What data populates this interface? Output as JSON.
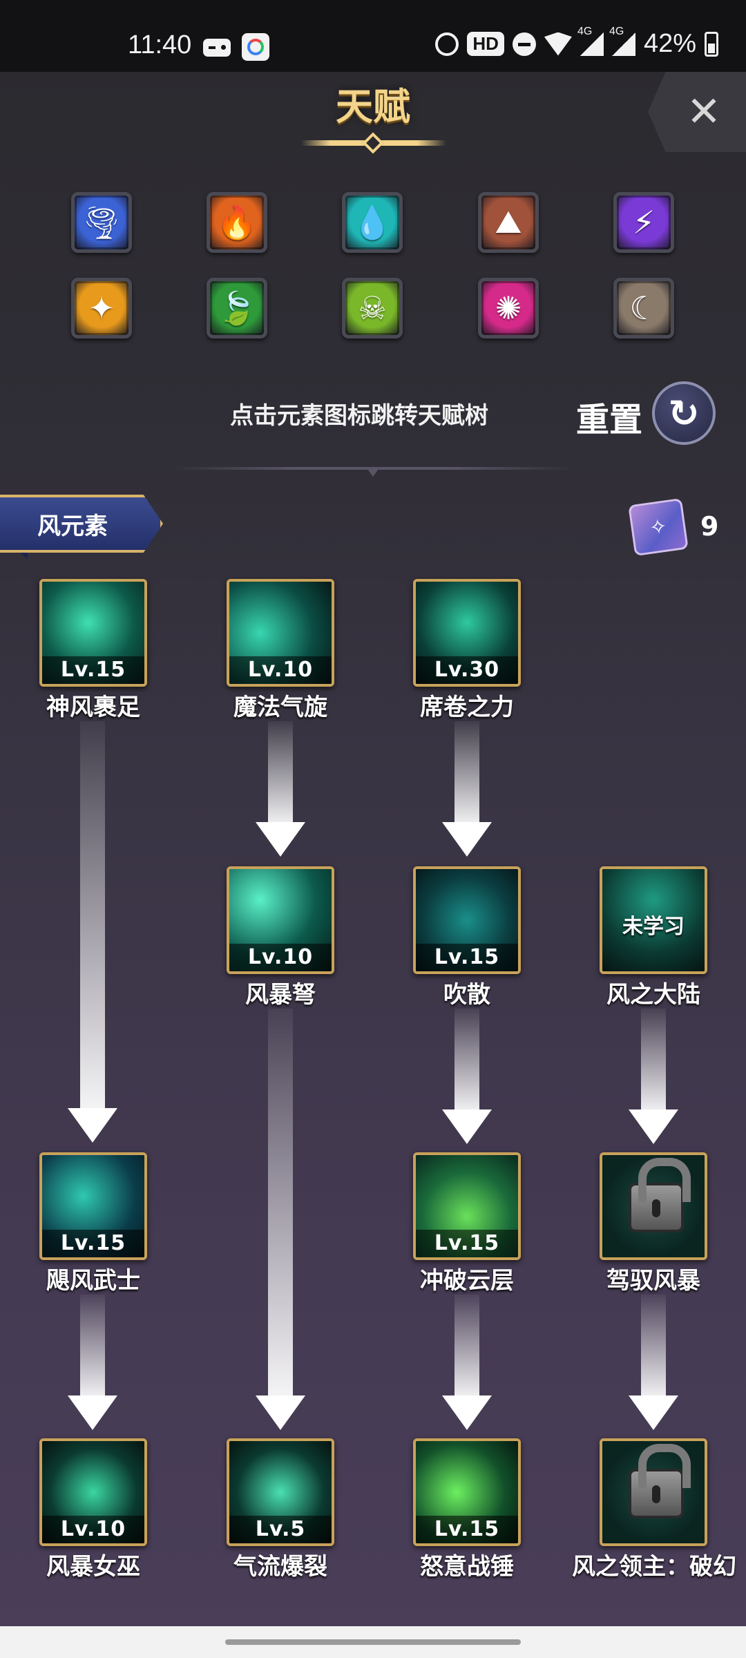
{
  "status_bar": {
    "time": "11:40",
    "hd_label": "HD",
    "network_1": "4G",
    "network_2": "4G",
    "battery": "42%"
  },
  "header": {
    "title": "天赋",
    "close_symbol": "✕"
  },
  "elements": [
    {
      "name": "tornado-icon",
      "glyph": "🌪",
      "color": "#3c63d6"
    },
    {
      "name": "fire-icon",
      "glyph": "🔥",
      "color": "#e0631e"
    },
    {
      "name": "water-drop-icon",
      "glyph": "💧",
      "color": "#1fb6b6"
    },
    {
      "name": "earth-crack-icon",
      "glyph": "⛰",
      "color": "#a0523a"
    },
    {
      "name": "lightning-icon",
      "glyph": "⚡",
      "color": "#7a3ad6"
    },
    {
      "name": "light-prism-icon",
      "glyph": "✦",
      "color": "#e89a1c"
    },
    {
      "name": "leaf-icon",
      "glyph": "🍃",
      "color": "#2e9a3a"
    },
    {
      "name": "poison-skull-icon",
      "glyph": "☠",
      "color": "#7ab82a"
    },
    {
      "name": "sun-burst-icon",
      "glyph": "✺",
      "color": "#d62a8a"
    },
    {
      "name": "moon-icon",
      "glyph": "☾",
      "color": "#8a7a6a"
    }
  ],
  "hint_text": "点击元素图标跳转天赋树",
  "reset_label": "重置",
  "reset_icon": "↻",
  "banner_label": "风元素",
  "scroll_count": "9",
  "skills": [
    {
      "name": "神风裹足",
      "level": "Lv.15"
    },
    {
      "name": "魔法气旋",
      "level": "Lv.10"
    },
    {
      "name": "席卷之力",
      "level": "Lv.30"
    },
    {
      "name": "风暴弩",
      "level": "Lv.10"
    },
    {
      "name": "吹散",
      "level": "Lv.15"
    },
    {
      "name": "风之大陆",
      "status": "未学习"
    },
    {
      "name": "飓风武士",
      "level": "Lv.15"
    },
    {
      "name": "冲破云层",
      "level": "Lv.15"
    },
    {
      "name": "驾驭风暴"
    },
    {
      "name": "风暴女巫",
      "level": "Lv.10"
    },
    {
      "name": "气流爆裂",
      "level": "Lv.5"
    },
    {
      "name": "怒意战锤",
      "level": "Lv.15"
    },
    {
      "name": "风之领主：破幻"
    }
  ]
}
